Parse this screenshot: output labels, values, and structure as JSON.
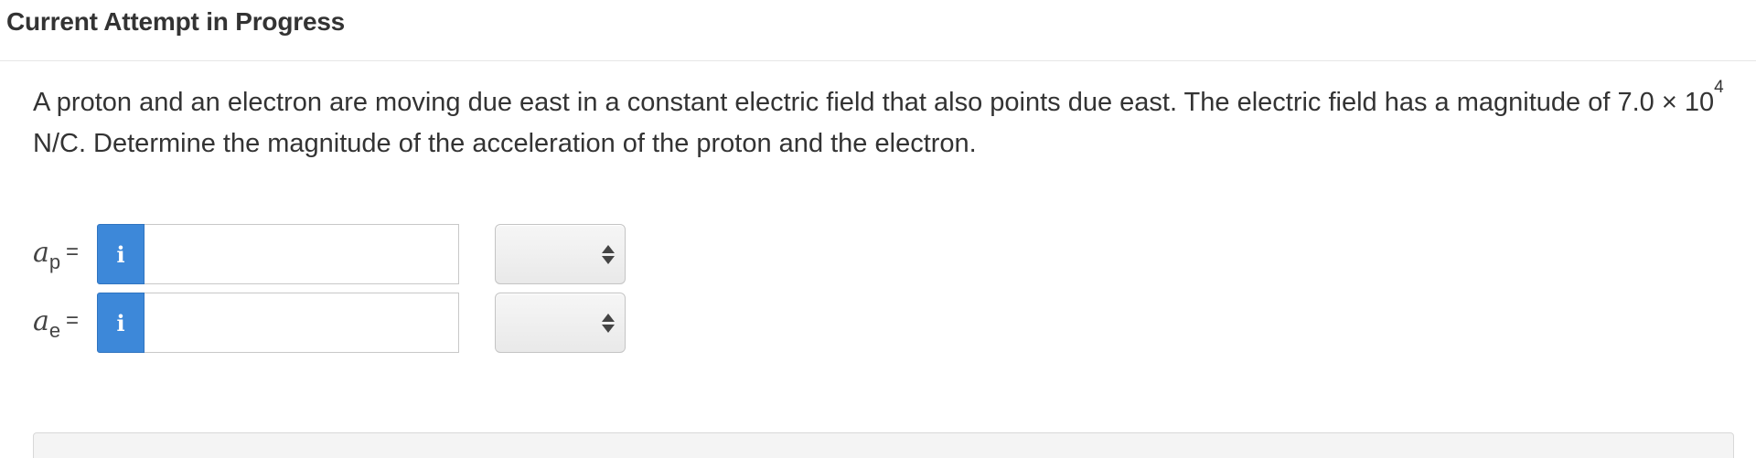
{
  "header": {
    "title": "Current Attempt in Progress"
  },
  "question": {
    "text_before_exponent": "A proton and an electron are moving due east in a constant electric field that also points due east. The electric field has a magnitude of 7.0 × 10",
    "exponent": "4",
    "text_after_exponent": " N/C. Determine the magnitude of the acceleration of the proton and the electron."
  },
  "answers": [
    {
      "variable": "a",
      "subscript": "p",
      "equals": "=",
      "info_icon": "info-icon",
      "info_glyph": "i",
      "value": "",
      "unit_selected": ""
    },
    {
      "variable": "a",
      "subscript": "e",
      "equals": "=",
      "info_icon": "info-icon",
      "info_glyph": "i",
      "value": "",
      "unit_selected": ""
    }
  ],
  "colors": {
    "info_button": "#3d88d9",
    "text": "#333333"
  }
}
